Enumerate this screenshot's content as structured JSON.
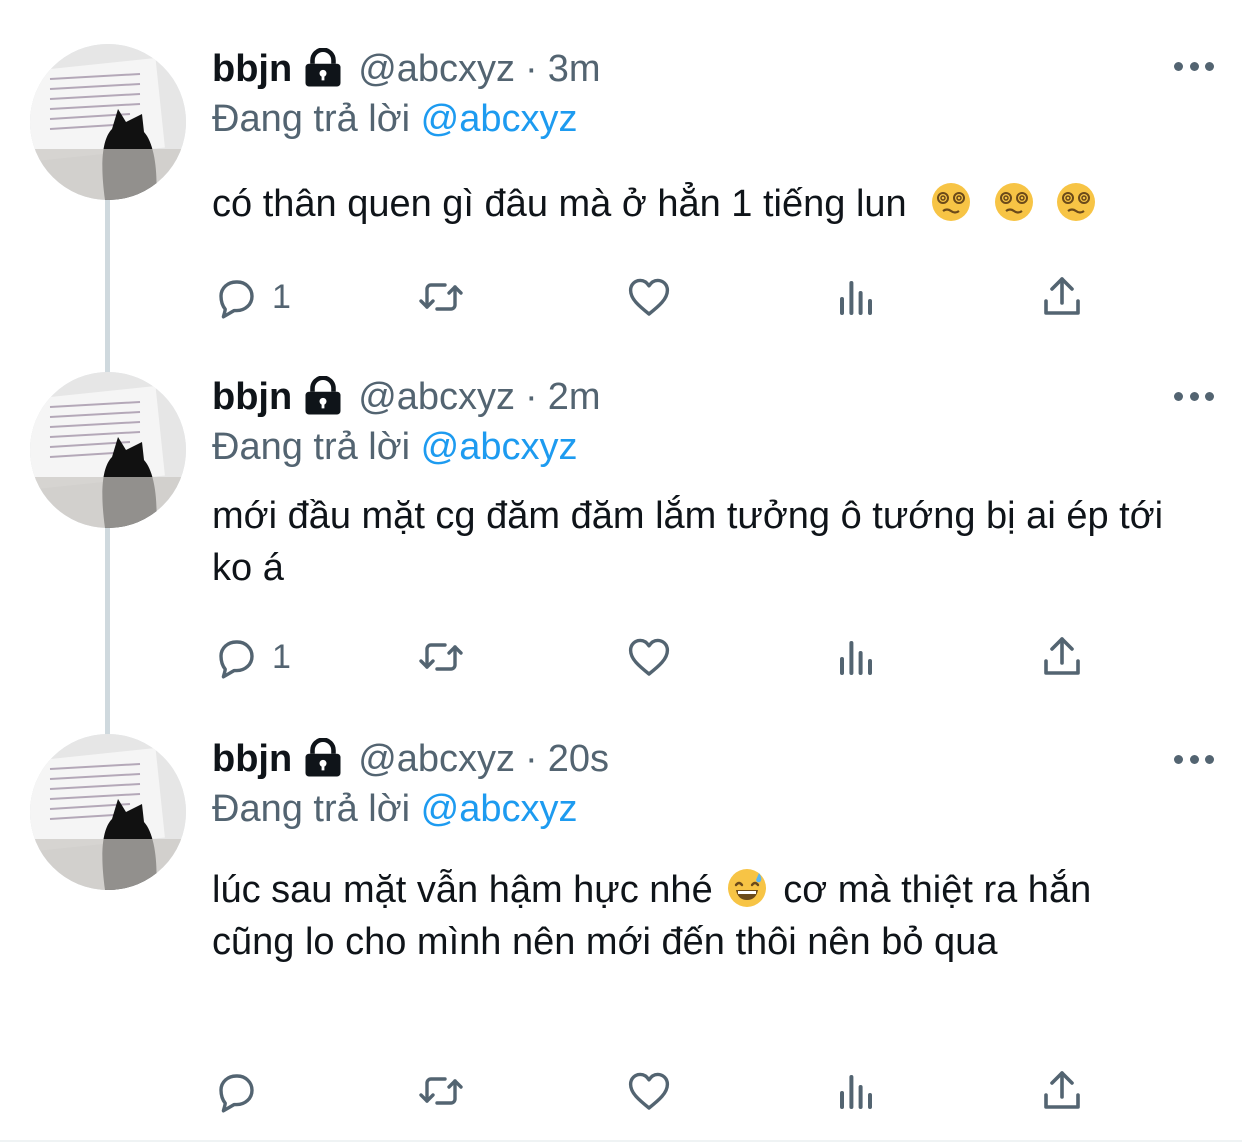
{
  "tweets": [
    {
      "name": "bbjn",
      "handle": "@abcxyz",
      "dot": "·",
      "time": "3m",
      "reply_prefix": "Đang trả lời",
      "reply_to": "@abcxyz",
      "text_before": "có thân quen gì đâu mà ở hẳn 1 tiếng lun",
      "emoji": [
        "dizzy-face-emoji",
        "dizzy-face-emoji",
        "dizzy-face-emoji"
      ],
      "text_after": "",
      "reply_count": "1"
    },
    {
      "name": "bbjn",
      "handle": "@abcxyz",
      "dot": "·",
      "time": "2m",
      "reply_prefix": "Đang trả lời",
      "reply_to": "@abcxyz",
      "text_before": "mới đầu mặt cg đăm đăm lắm tưởng ô tướng bị ai ép tới ko á",
      "emoji": [],
      "text_after": "",
      "reply_count": "1"
    },
    {
      "name": "bbjn",
      "handle": "@abcxyz",
      "dot": "·",
      "time": "20s",
      "reply_prefix": "Đang trả lời",
      "reply_to": "@abcxyz",
      "text_before": "lúc sau mặt vẫn hậm hực nhé",
      "emoji": [
        "grinning-sweat-emoji"
      ],
      "text_after": " cơ mà thiệt ra hắn cũng lo cho mình nên mới đến thôi nên bỏ qua",
      "reply_count": ""
    }
  ],
  "colors": {
    "text": "#0f1419",
    "secondary": "#536471",
    "link": "#1d9bf0",
    "thread_line": "#cfd9de"
  }
}
